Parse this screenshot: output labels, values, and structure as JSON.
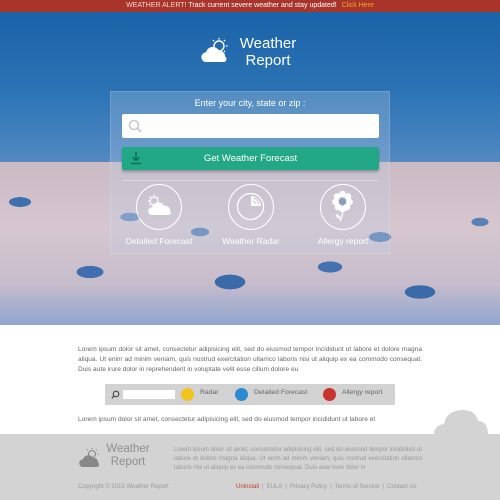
{
  "alert": {
    "prefix": "WEATHER ALERT!",
    "message": "Track current severe weather and stay updated!",
    "link": "Click Here"
  },
  "logo": {
    "line1": "Weather",
    "line2": "Report"
  },
  "search": {
    "prompt": "Enter your city, state or zip :",
    "value": "",
    "placeholder": "",
    "button_label": "Get Weather Forecast"
  },
  "features": [
    {
      "label": "Detailed Forecast",
      "icon": "sun-cloud-icon"
    },
    {
      "label": "Weather Radar",
      "icon": "radar-icon"
    },
    {
      "label": "Allergy report",
      "icon": "flower-icon"
    }
  ],
  "content": {
    "paragraph1": "Lorem ipsum dolor sit amet, consectetur adipisicing elit, sed do eiusmod tempor incididunt ut labore et dolore magna aliqua. Ut enim ad minim veniam, quis nostrud exercitation ullamco laboris nisi ut aliquip ex ea commodo consequat. Duis aute irure dolor in reprehenderit in voluptate velit esse cillum dolore eu",
    "paragraph2": "Lorem ipsum dolor sit amet, consectetur adipisicing elit, sed do eiusmod tempor incididunt ut labore et"
  },
  "toolbar": {
    "search_value": "",
    "items": [
      {
        "label": "Radar",
        "color": "#f2c31e"
      },
      {
        "label": "Detailed Forecast",
        "color": "#2a8ad2"
      },
      {
        "label": "Allergy report",
        "color": "#c8342c"
      }
    ]
  },
  "footer": {
    "logo_line1": "Weather",
    "logo_line2": "Report",
    "text": "Lorem ipsum dolor sit amet, consectetur adipisicing elit, sed do eiusmod tempor incididunt ut labore et dolore magna aliqua. Ut enim ad minim veniam, quis nostrud exercitation ullamco laboris nisi ut aliquip ex ea commodo consequat. Duis aute irure dolor in",
    "copyright": "Copyright © 2015 Weather Report",
    "links": [
      "Uninstall",
      "EULA",
      "Privacy Policy",
      "Terms of Service",
      "Contact Us"
    ]
  },
  "colors": {
    "alert_bg": "#a8342a",
    "alert_link": "#f5a623",
    "accent_green": "#22a886",
    "uninstall_red": "#c0392b"
  }
}
